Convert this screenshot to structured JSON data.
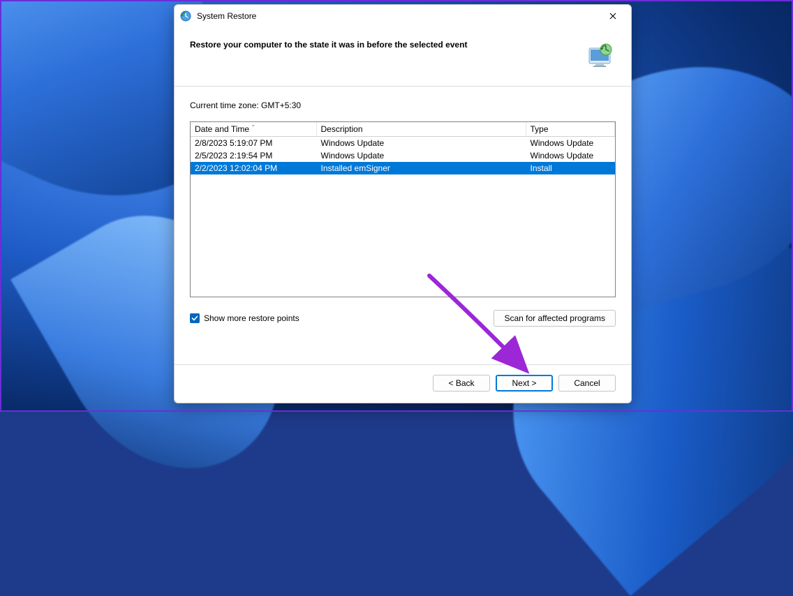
{
  "window": {
    "title": "System Restore"
  },
  "header": {
    "heading": "Restore your computer to the state it was in before the selected event"
  },
  "body": {
    "timezone_label": "Current time zone: GMT+5:30",
    "columns": {
      "date": "Date and Time",
      "description": "Description",
      "type": "Type"
    },
    "rows": [
      {
        "date": "2/8/2023 5:19:07 PM",
        "description": "Windows Update",
        "type": "Windows Update",
        "selected": false
      },
      {
        "date": "2/5/2023 2:19:54 PM",
        "description": "Windows Update",
        "type": "Windows Update",
        "selected": false
      },
      {
        "date": "2/2/2023 12:02:04 PM",
        "description": "Installed emSigner",
        "type": "Install",
        "selected": true
      }
    ],
    "checkbox_label": "Show more restore points",
    "checkbox_checked": true,
    "scan_button": "Scan for affected programs"
  },
  "footer": {
    "back": "< Back",
    "next": "Next >",
    "cancel": "Cancel"
  }
}
